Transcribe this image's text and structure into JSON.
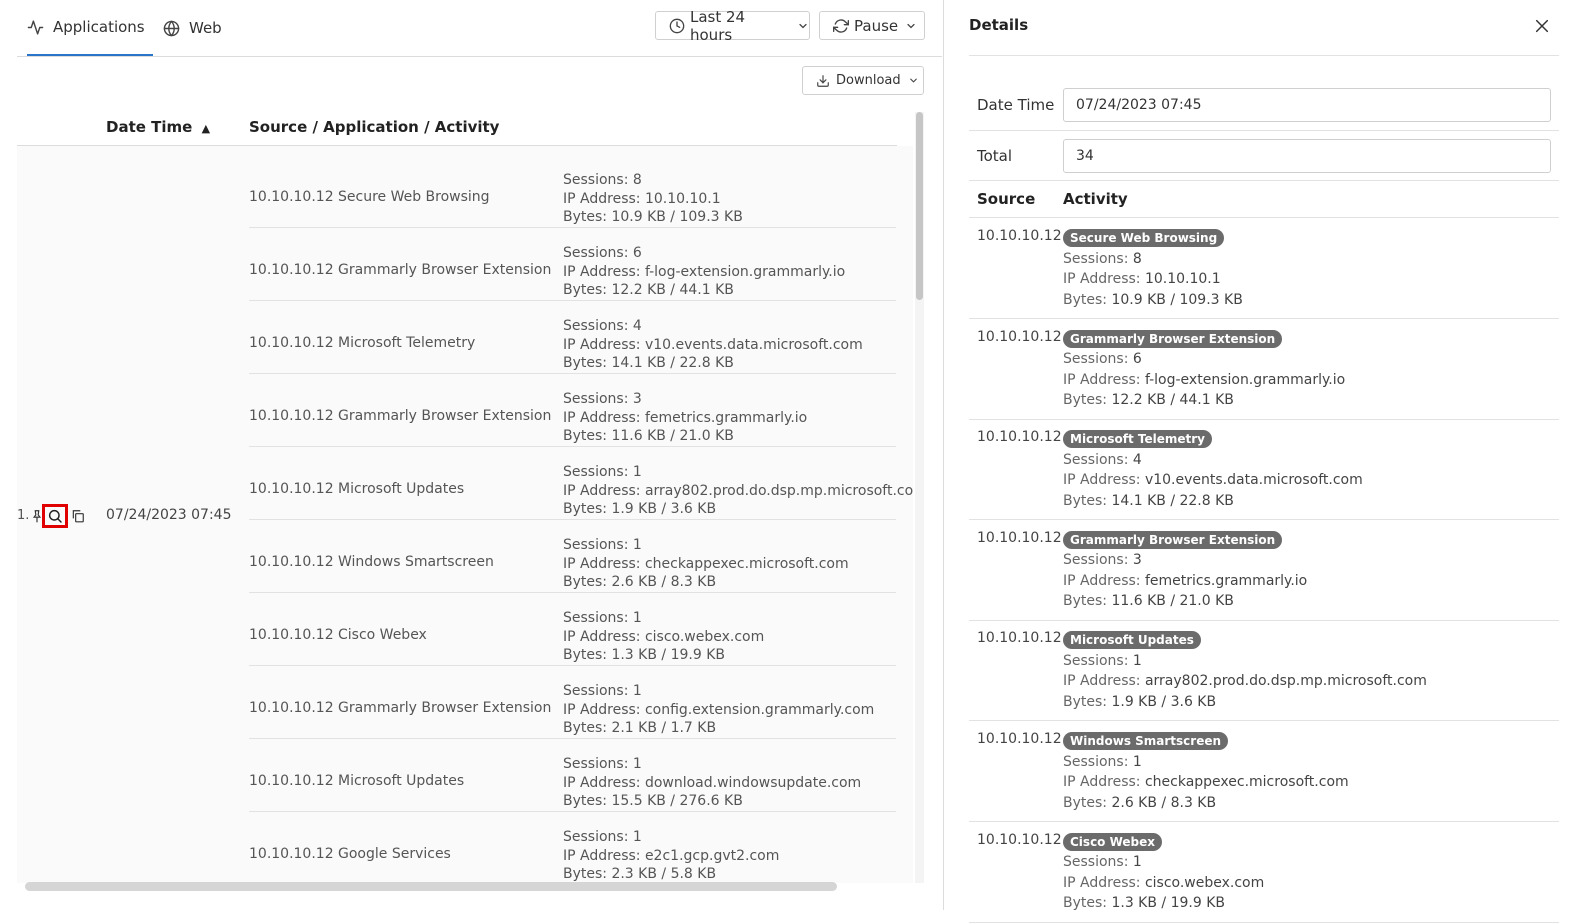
{
  "tabs": [
    {
      "label": "Applications",
      "icon": "activity-icon",
      "active": true
    },
    {
      "label": "Web",
      "icon": "globe-icon",
      "active": false
    }
  ],
  "toolbar": {
    "time_range": "Last 24 hours",
    "pause": "Pause",
    "download": "Download"
  },
  "table": {
    "columns": [
      "Date Time",
      "Source / Application / Activity"
    ],
    "row": {
      "index": "1.",
      "date_time": "07/24/2023 07:45"
    },
    "entries": [
      {
        "source": "10.10.10.12",
        "app": "Secure Web Browsing",
        "sessions": "Sessions: 8",
        "ip": "IP Address: 10.10.10.1",
        "bytes": "Bytes: 10.9 KB / 109.3 KB"
      },
      {
        "source": "10.10.10.12",
        "app": "Grammarly Browser Extension",
        "sessions": "Sessions: 6",
        "ip": "IP Address: f-log-extension.grammarly.io",
        "bytes": "Bytes: 12.2 KB / 44.1 KB"
      },
      {
        "source": "10.10.10.12",
        "app": "Microsoft Telemetry",
        "sessions": "Sessions: 4",
        "ip": "IP Address: v10.events.data.microsoft.com",
        "bytes": "Bytes: 14.1 KB / 22.8 KB"
      },
      {
        "source": "10.10.10.12",
        "app": "Grammarly Browser Extension",
        "sessions": "Sessions: 3",
        "ip": "IP Address: femetrics.grammarly.io",
        "bytes": "Bytes: 11.6 KB / 21.0 KB"
      },
      {
        "source": "10.10.10.12",
        "app": "Microsoft Updates",
        "sessions": "Sessions: 1",
        "ip": "IP Address: array802.prod.do.dsp.mp.microsoft.com",
        "bytes": "Bytes: 1.9 KB / 3.6 KB"
      },
      {
        "source": "10.10.10.12",
        "app": "Windows Smartscreen",
        "sessions": "Sessions: 1",
        "ip": "IP Address: checkappexec.microsoft.com",
        "bytes": "Bytes: 2.6 KB / 8.3 KB"
      },
      {
        "source": "10.10.10.12",
        "app": "Cisco Webex",
        "sessions": "Sessions: 1",
        "ip": "IP Address: cisco.webex.com",
        "bytes": "Bytes: 1.3 KB / 19.9 KB"
      },
      {
        "source": "10.10.10.12",
        "app": "Grammarly Browser Extension",
        "sessions": "Sessions: 1",
        "ip": "IP Address: config.extension.grammarly.com",
        "bytes": "Bytes: 2.1 KB / 1.7 KB"
      },
      {
        "source": "10.10.10.12",
        "app": "Microsoft Updates",
        "sessions": "Sessions: 1",
        "ip": "IP Address: download.windowsupdate.com",
        "bytes": "Bytes: 15.5 KB / 276.6 KB"
      },
      {
        "source": "10.10.10.12",
        "app": "Google Services",
        "sessions": "Sessions: 1",
        "ip": "IP Address: e2c1.gcp.gvt2.com",
        "bytes": "Bytes: 2.3 KB / 5.8 KB"
      }
    ]
  },
  "details": {
    "title": "Details",
    "date_time_label": "Date Time",
    "date_time_value": "07/24/2023 07:45",
    "total_label": "Total",
    "total_value": "34",
    "col_source": "Source",
    "col_activity": "Activity",
    "sessions_label": "Sessions:",
    "ip_label": "IP Address:",
    "bytes_label": "Bytes:",
    "rows": [
      {
        "source": "10.10.10.12",
        "app": "Secure Web Browsing",
        "sessions": "8",
        "ip": "10.10.10.1",
        "bytes": "10.9 KB / 109.3 KB"
      },
      {
        "source": "10.10.10.12",
        "app": "Grammarly Browser Extension",
        "sessions": "6",
        "ip": "f-log-extension.grammarly.io",
        "bytes": "12.2 KB / 44.1 KB"
      },
      {
        "source": "10.10.10.12",
        "app": "Microsoft Telemetry",
        "sessions": "4",
        "ip": "v10.events.data.microsoft.com",
        "bytes": "14.1 KB / 22.8 KB"
      },
      {
        "source": "10.10.10.12",
        "app": "Grammarly Browser Extension",
        "sessions": "3",
        "ip": "femetrics.grammarly.io",
        "bytes": "11.6 KB / 21.0 KB"
      },
      {
        "source": "10.10.10.12",
        "app": "Microsoft Updates",
        "sessions": "1",
        "ip": "array802.prod.do.dsp.mp.microsoft.com",
        "bytes": "1.9 KB / 3.6 KB"
      },
      {
        "source": "10.10.10.12",
        "app": "Windows Smartscreen",
        "sessions": "1",
        "ip": "checkappexec.microsoft.com",
        "bytes": "2.6 KB / 8.3 KB"
      },
      {
        "source": "10.10.10.12",
        "app": "Cisco Webex",
        "sessions": "1",
        "ip": "cisco.webex.com",
        "bytes": "1.3 KB / 19.9 KB"
      }
    ]
  },
  "colors": {
    "accent": "#2a74c9",
    "badge": "#6b6b6b",
    "highlight": "#e00000"
  }
}
